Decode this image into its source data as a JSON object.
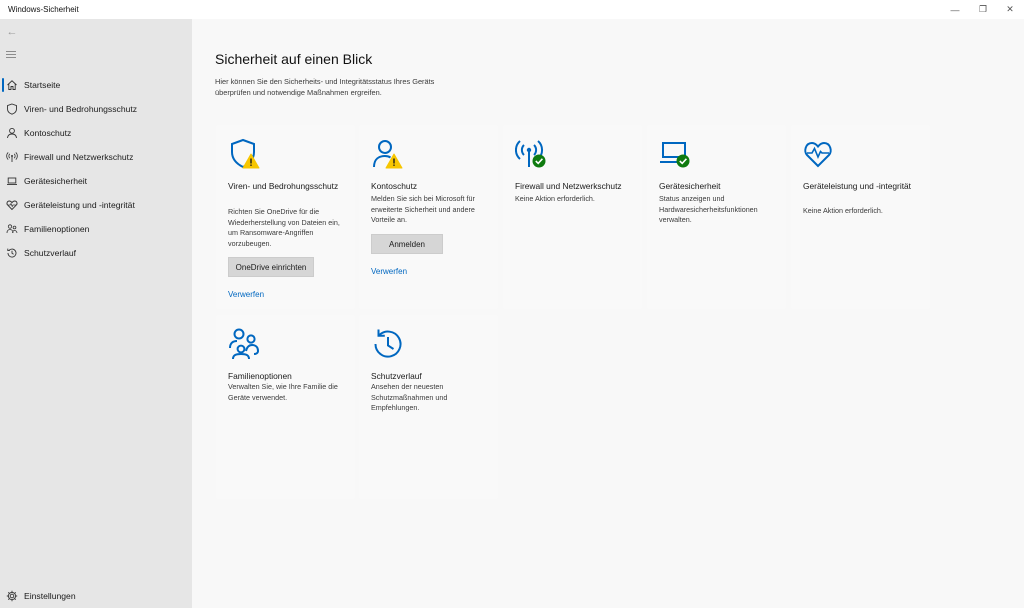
{
  "window": {
    "title": "Windows-Sicherheit",
    "minimize_glyph": "—",
    "maximize_glyph": "❐",
    "close_glyph": "✕"
  },
  "sidebar": {
    "back_glyph": "←",
    "items": [
      {
        "label": "Startseite",
        "icon": "home-icon"
      },
      {
        "label": "Viren- und Bedrohungsschutz",
        "icon": "shield-icon"
      },
      {
        "label": "Kontoschutz",
        "icon": "person-icon"
      },
      {
        "label": "Firewall und Netzwerkschutz",
        "icon": "antenna-icon"
      },
      {
        "label": "Gerätesicherheit",
        "icon": "laptop-icon"
      },
      {
        "label": "Geräteleistung und -integrität",
        "icon": "heart-icon"
      },
      {
        "label": "Familienoptionen",
        "icon": "family-icon"
      },
      {
        "label": "Schutzverlauf",
        "icon": "history-icon"
      }
    ],
    "settings_label": "Einstellungen"
  },
  "main": {
    "title": "Sicherheit auf einen Blick",
    "description": "Hier können Sie den Sicherheits- und Integritätsstatus Ihres Geräts überprüfen und notwendige Maßnahmen ergreifen.",
    "cards": [
      {
        "title": "Viren- und Bedrohungsschutz",
        "description": "Richten Sie OneDrive für die Wiederherstellung von Dateien ein, um Ransomware-Angriffen vorzubeugen.",
        "button": "OneDrive einrichten",
        "link": "Verwerfen",
        "status": "warning"
      },
      {
        "title": "Kontoschutz",
        "description": "Melden Sie sich bei Microsoft für erweiterte Sicherheit und andere Vorteile an.",
        "button": "Anmelden",
        "link": "Verwerfen",
        "status": "warning"
      },
      {
        "title": "Firewall und Netzwerkschutz",
        "description": "Keine Aktion erforderlich.",
        "status": "ok"
      },
      {
        "title": "Gerätesicherheit",
        "description": "Status anzeigen und Hardwaresicherheitsfunktionen verwalten.",
        "status": "ok"
      },
      {
        "title": "Geräteleistung und -integrität",
        "description": "Keine Aktion erforderlich.",
        "status": "none"
      },
      {
        "title": "Familienoptionen",
        "description": "Verwalten Sie, wie Ihre Familie die Geräte verwendet.",
        "status": "none"
      },
      {
        "title": "Schutzverlauf",
        "description": "Ansehen der neuesten Schutzmaßnahmen und Empfehlungen.",
        "status": "none"
      }
    ]
  },
  "colors": {
    "accent": "#0067c0",
    "warning": "#f7c600",
    "ok": "#0f7b0f",
    "sidebar_bg": "#e6e6e6",
    "main_bg": "#f8f8f8"
  }
}
